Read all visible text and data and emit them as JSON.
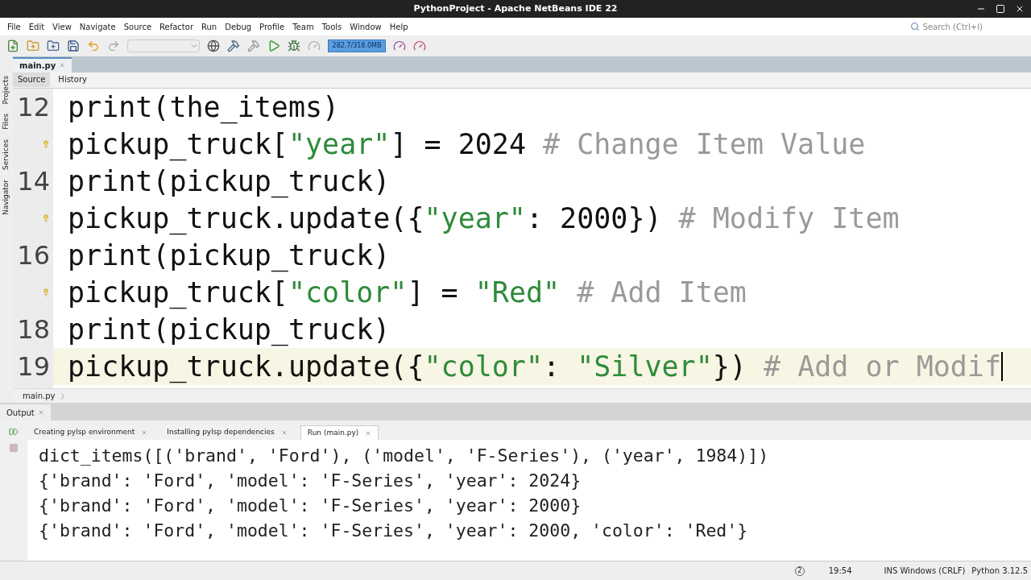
{
  "window": {
    "title": "PythonProject - Apache NetBeans IDE 22"
  },
  "menu": [
    "File",
    "Edit",
    "View",
    "Navigate",
    "Source",
    "Refactor",
    "Run",
    "Debug",
    "Profile",
    "Team",
    "Tools",
    "Window",
    "Help"
  ],
  "search": {
    "placeholder": "Search (Ctrl+I)"
  },
  "toolbar": {
    "memory": "282.7/318.0MB"
  },
  "side_panels": [
    "Projects",
    "Files",
    "Services",
    "Navigator"
  ],
  "editor_tabs": [
    {
      "label": "main.py",
      "selected": true
    }
  ],
  "view_tabs": [
    {
      "label": "Source",
      "selected": true
    },
    {
      "label": "History",
      "selected": false
    }
  ],
  "code_lines": [
    {
      "number": "12",
      "hint": false,
      "current": false,
      "tokens": [
        {
          "kind": "plain",
          "text": "print(the_items)"
        }
      ]
    },
    {
      "hint": true,
      "current": false,
      "tokens": [
        {
          "kind": "plain",
          "text": "pickup_truck["
        },
        {
          "kind": "string",
          "text": "\"year\""
        },
        {
          "kind": "plain",
          "text": "] = 2024"
        },
        {
          "kind": "comment",
          "text": " # Change Item Value"
        }
      ]
    },
    {
      "number": "14",
      "hint": false,
      "current": false,
      "tokens": [
        {
          "kind": "plain",
          "text": "print(pickup_truck)"
        }
      ]
    },
    {
      "hint": true,
      "current": false,
      "tokens": [
        {
          "kind": "plain",
          "text": "pickup_truck.update({"
        },
        {
          "kind": "string",
          "text": "\"year\""
        },
        {
          "kind": "plain",
          "text": ": 2000})"
        },
        {
          "kind": "comment",
          "text": " # Modify Item"
        }
      ]
    },
    {
      "number": "16",
      "hint": false,
      "current": false,
      "tokens": [
        {
          "kind": "plain",
          "text": "print(pickup_truck)"
        }
      ]
    },
    {
      "hint": true,
      "current": false,
      "tokens": [
        {
          "kind": "plain",
          "text": "pickup_truck["
        },
        {
          "kind": "string",
          "text": "\"color\""
        },
        {
          "kind": "plain",
          "text": "] = "
        },
        {
          "kind": "string",
          "text": "\"Red\""
        },
        {
          "kind": "comment",
          "text": " # Add Item"
        }
      ]
    },
    {
      "number": "18",
      "hint": false,
      "current": false,
      "tokens": [
        {
          "kind": "plain",
          "text": "print(pickup_truck)"
        }
      ]
    },
    {
      "number": "19",
      "hint": false,
      "current": true,
      "tokens": [
        {
          "kind": "plain",
          "text": "pickup_truck.update({"
        },
        {
          "kind": "string",
          "text": "\"color\""
        },
        {
          "kind": "plain",
          "text": ": "
        },
        {
          "kind": "string",
          "text": "\"Silver\""
        },
        {
          "kind": "plain",
          "text": "})"
        },
        {
          "kind": "comment",
          "text": " # Add or Modif"
        }
      ]
    }
  ],
  "breadcrumb": "main.py",
  "output_panel": {
    "title": "Output"
  },
  "output_tabs": [
    {
      "label": "Creating pylsp environment",
      "selected": false
    },
    {
      "label": "Installing pylsp dependencies",
      "selected": false
    },
    {
      "label": "Run (main.py)",
      "selected": true
    }
  ],
  "output_lines": [
    "dict_items([('brand', 'Ford'), ('model', 'F-Series'), ('year', 1984)])",
    "{'brand': 'Ford', 'model': 'F-Series', 'year': 2024}",
    "{'brand': 'Ford', 'model': 'F-Series', 'year': 2000}",
    "{'brand': 'Ford', 'model': 'F-Series', 'year': 2000, 'color': 'Red'}"
  ],
  "status_bar": {
    "notifications": "2",
    "position": "19:54",
    "mode": "INS Windows (CRLF)",
    "language": "Python 3.12.5"
  }
}
